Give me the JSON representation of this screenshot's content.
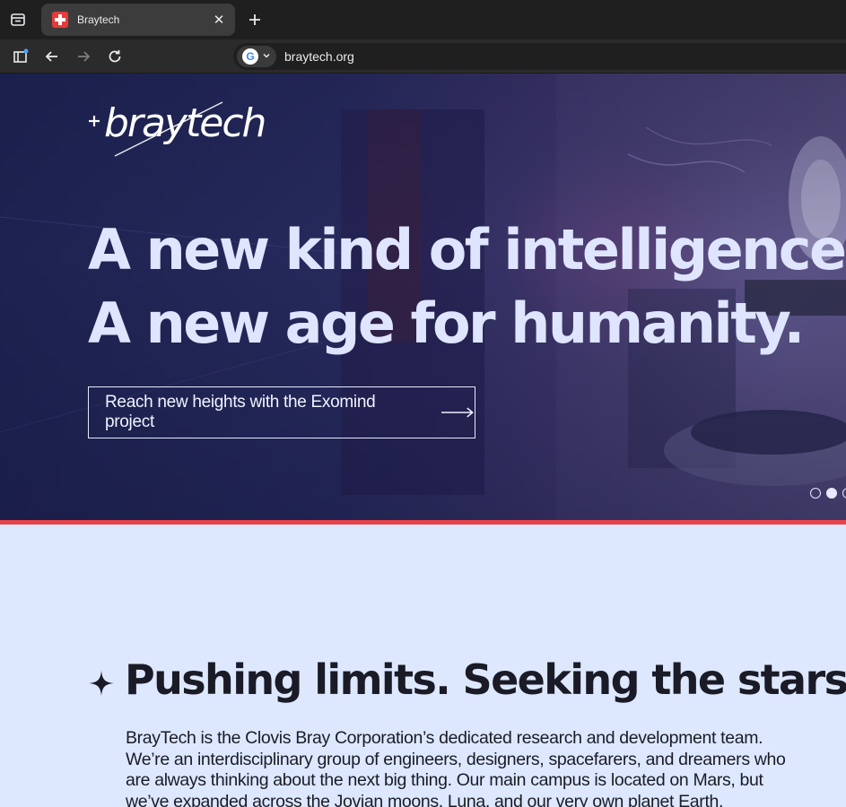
{
  "browser": {
    "tab": {
      "title": "Braytech"
    },
    "address_bar": {
      "url": "braytech.org"
    }
  },
  "hero": {
    "logo_text": "braytech",
    "headline": [
      "A new kind of intelligence.",
      "A new age for humanity."
    ],
    "cta_label": "Reach new heights with the Exomind project",
    "carousel": {
      "slides_visible": 3,
      "active_index": 1
    }
  },
  "colors": {
    "accent": "#e8434a",
    "hero_text": "#dfe5ff",
    "content_background": "#dde8ff",
    "content_text": "#1a1b26"
  },
  "section": {
    "title": "Pushing limits. Seeking the stars.",
    "body": "BrayTech is the Clovis Bray Corporation’s dedicated research and development team. We’re an interdisciplinary group of engineers, designers, spacefarers, and dreamers who are always thinking about the next big thing. Our main campus is located on Mars, but we’ve expanded across the Jovian moons, Luna, and our very own planet Earth."
  },
  "icons": {
    "tab_search": "tab-search-icon",
    "close": "close-icon",
    "new_tab": "plus-icon",
    "sidebar": "sidebar-icon",
    "back": "arrow-left-icon",
    "forward": "arrow-right-icon",
    "reload": "reload-icon",
    "google": "google-icon",
    "chevron": "chevron-down-icon",
    "sparkle": "sparkle-icon",
    "cta_arrow": "long-arrow-right-icon"
  }
}
